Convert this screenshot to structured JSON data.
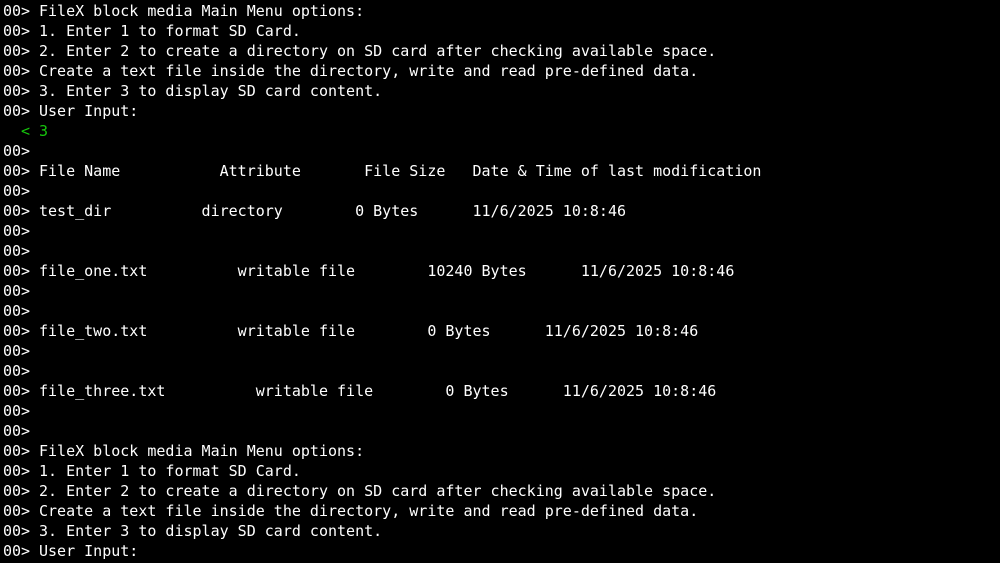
{
  "window": {
    "prompt_prefix": "00>",
    "input_prefix": "<"
  },
  "lines": [
    {
      "kind": "out",
      "text": "FileX block media Main Menu options:"
    },
    {
      "kind": "out",
      "text": "1. Enter 1 to format SD Card."
    },
    {
      "kind": "out",
      "text": "2. Enter 2 to create a directory on SD card after checking available space."
    },
    {
      "kind": "out",
      "text": "Create a text file inside the directory, write and read pre-defined data."
    },
    {
      "kind": "out",
      "text": "3. Enter 3 to display SD card content."
    },
    {
      "kind": "out",
      "text": "User Input:"
    },
    {
      "kind": "in",
      "text": "3"
    },
    {
      "kind": "out",
      "text": ""
    },
    {
      "kind": "out",
      "text": "File Name           Attribute       File Size   Date & Time of last modification"
    },
    {
      "kind": "out",
      "text": ""
    },
    {
      "kind": "out",
      "text": "test_dir          directory        0 Bytes      11/6/2025 10:8:46"
    },
    {
      "kind": "out",
      "text": ""
    },
    {
      "kind": "out",
      "text": ""
    },
    {
      "kind": "out",
      "text": "file_one.txt          writable file        10240 Bytes      11/6/2025 10:8:46"
    },
    {
      "kind": "out",
      "text": ""
    },
    {
      "kind": "out",
      "text": ""
    },
    {
      "kind": "out",
      "text": "file_two.txt          writable file        0 Bytes      11/6/2025 10:8:46"
    },
    {
      "kind": "out",
      "text": ""
    },
    {
      "kind": "out",
      "text": ""
    },
    {
      "kind": "out",
      "text": "file_three.txt          writable file        0 Bytes      11/6/2025 10:8:46"
    },
    {
      "kind": "out",
      "text": ""
    },
    {
      "kind": "out",
      "text": ""
    },
    {
      "kind": "out",
      "text": "FileX block media Main Menu options:"
    },
    {
      "kind": "out",
      "text": "1. Enter 1 to format SD Card."
    },
    {
      "kind": "out",
      "text": "2. Enter 2 to create a directory on SD card after checking available space."
    },
    {
      "kind": "out",
      "text": "Create a text file inside the directory, write and read pre-defined data."
    },
    {
      "kind": "out",
      "text": "3. Enter 3 to display SD card content."
    },
    {
      "kind": "out",
      "text": "User Input:"
    }
  ],
  "colors": {
    "background": "#000000",
    "output_text": "#ffffff",
    "input_text": "#16c60c"
  }
}
